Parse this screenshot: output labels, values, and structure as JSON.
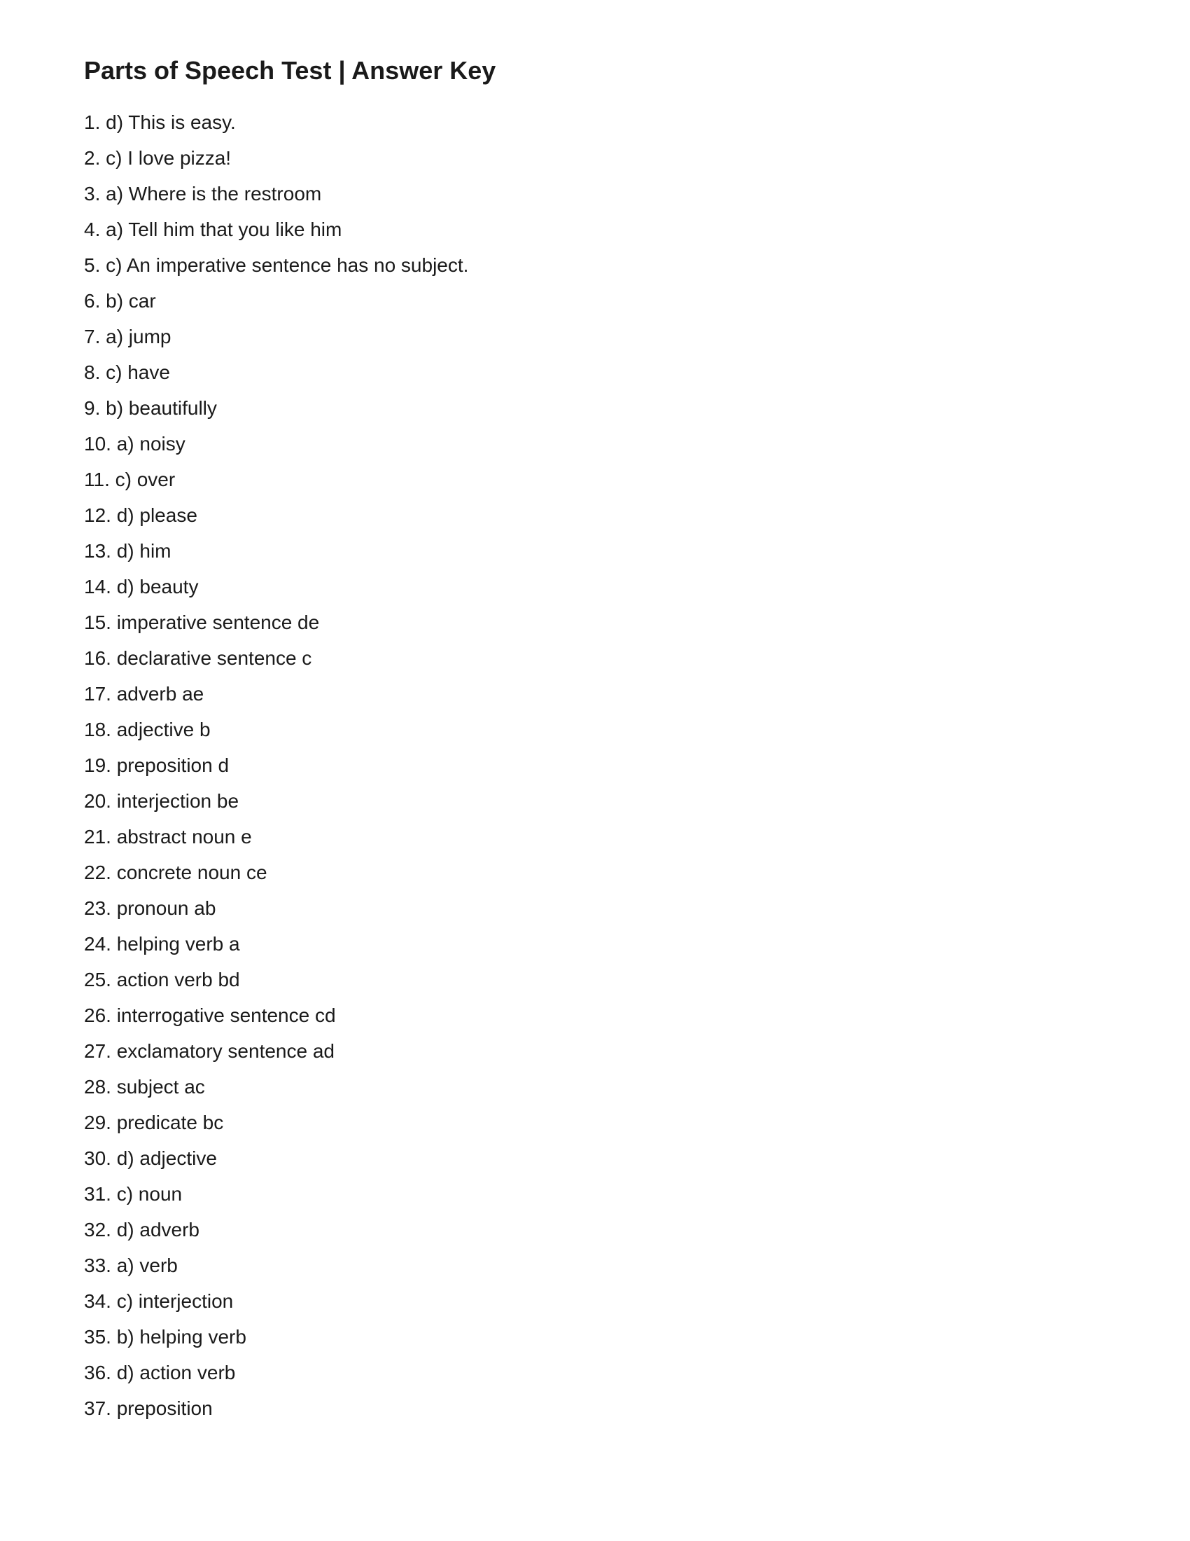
{
  "page": {
    "title": "Parts of Speech Test | Answer Key",
    "answers": [
      "1. d) This is easy.",
      "2. c) I love pizza!",
      "3. a) Where is the restroom",
      "4. a) Tell him that you like him",
      "5. c) An imperative sentence has no subject.",
      "6. b) car",
      "7. a) jump",
      "8. c) have",
      "9. b) beautifully",
      "10. a) noisy",
      "11. c) over",
      "12. d) please",
      "13. d) him",
      "14. d) beauty",
      "15. imperative sentence de",
      "16. declarative sentence c",
      "17. adverb ae",
      "18. adjective b",
      "19. preposition d",
      "20. interjection be",
      "21. abstract noun e",
      "22. concrete noun ce",
      "23. pronoun ab",
      "24. helping verb a",
      "25. action verb bd",
      "26. interrogative sentence cd",
      "27. exclamatory sentence ad",
      "28. subject ac",
      "29. predicate bc",
      "30. d) adjective",
      "31. c) noun",
      "32. d) adverb",
      "33. a) verb",
      "34. c) interjection",
      "35. b) helping verb",
      "36. d) action verb",
      "37. preposition"
    ]
  }
}
